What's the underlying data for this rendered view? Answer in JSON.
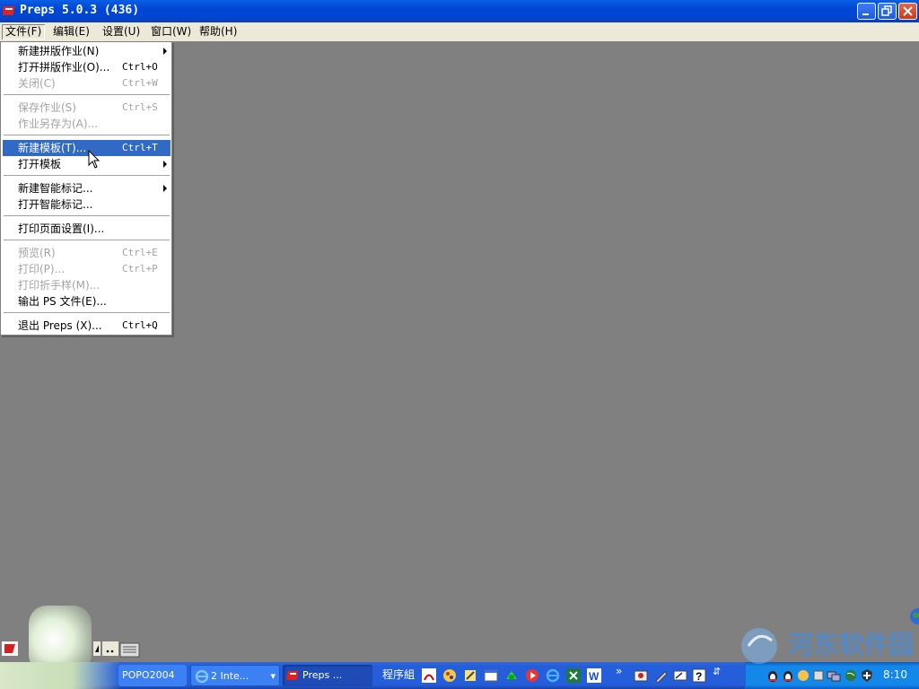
{
  "window": {
    "title": "Preps 5.0.3 (436)"
  },
  "menubar": {
    "items": [
      {
        "label": "文件(F)"
      },
      {
        "label": "编辑(E)"
      },
      {
        "label": "设置(U)"
      },
      {
        "label": "窗口(W)"
      },
      {
        "label": "帮助(H)"
      }
    ]
  },
  "file_menu": {
    "items": [
      {
        "label": "新建拼版作业(N)",
        "shortcut": "",
        "submenu": true,
        "disabled": false
      },
      {
        "label": "打开拼版作业(O)...",
        "shortcut": "Ctrl+O",
        "submenu": false,
        "disabled": false
      },
      {
        "label": "关闭(C)",
        "shortcut": "Ctrl+W",
        "submenu": false,
        "disabled": true
      },
      {
        "label": "保存作业(S)",
        "shortcut": "Ctrl+S",
        "submenu": false,
        "disabled": true
      },
      {
        "label": "作业另存为(A)...",
        "shortcut": "",
        "submenu": false,
        "disabled": true
      },
      {
        "label": "新建模板(T)...",
        "shortcut": "Ctrl+T",
        "submenu": false,
        "disabled": false,
        "highlighted": true
      },
      {
        "label": "打开模板",
        "shortcut": "",
        "submenu": true,
        "disabled": false
      },
      {
        "label": "新建智能标记...",
        "shortcut": "",
        "submenu": true,
        "disabled": false
      },
      {
        "label": "打开智能标记...",
        "shortcut": "",
        "submenu": false,
        "disabled": false
      },
      {
        "label": "打印页面设置(I)...",
        "shortcut": "",
        "submenu": false,
        "disabled": false
      },
      {
        "label": "预览(R)",
        "shortcut": "Ctrl+E",
        "submenu": false,
        "disabled": true
      },
      {
        "label": "打印(P)...",
        "shortcut": "Ctrl+P",
        "submenu": false,
        "disabled": true
      },
      {
        "label": "打印折手样(M)...",
        "shortcut": "",
        "submenu": false,
        "disabled": true
      },
      {
        "label": "输出 PS 文件(E)...",
        "shortcut": "",
        "submenu": false,
        "disabled": false
      },
      {
        "label": "退出 Preps (X)...",
        "shortcut": "Ctrl+Q",
        "submenu": false,
        "disabled": false
      }
    ]
  },
  "taskbar": {
    "buttons": [
      {
        "label": "POPO2004"
      },
      {
        "label": "2 Inte..."
      },
      {
        "label": "Preps ..."
      }
    ],
    "group_label": "程序組",
    "clock": "8:10"
  },
  "watermark": "河东软件园",
  "colors": {
    "titlebar": "#0046d5",
    "menu_highlight": "#316ac5",
    "client_bg": "#808080",
    "taskbar": "#245edb"
  }
}
